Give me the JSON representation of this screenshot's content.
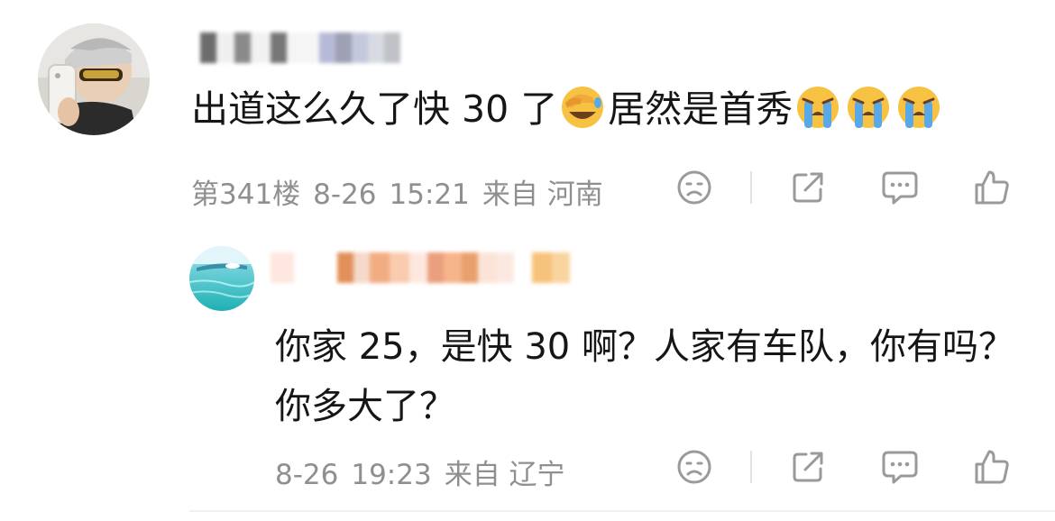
{
  "comment": {
    "text_before": "出道这么久了快 30 了",
    "text_middle": "居然是首秀",
    "emoji_1": "face-with-hand-over-eyes-laughing-icon",
    "emoji_2": "loudly-crying-face-icon",
    "meta": {
      "floor": "第341楼",
      "date": "8-26",
      "time": "15:21",
      "location": "来自 河南"
    }
  },
  "reply": {
    "text": "你家 25，是快 30 啊？人家有车队，你有吗？你多大了？",
    "meta": {
      "date": "8-26",
      "time": "19:23",
      "location": "来自 辽宁"
    }
  },
  "colors": {
    "text_primary": "#161616",
    "text_meta": "#8f8f8f",
    "icon_gray": "#9a9a9a",
    "emoji_yellow": "#f7c242",
    "tear_blue": "#59a9e8"
  },
  "icons": [
    "dislike-face-icon",
    "share-icon",
    "reply-bubble-icon",
    "thumbs-up-icon"
  ]
}
